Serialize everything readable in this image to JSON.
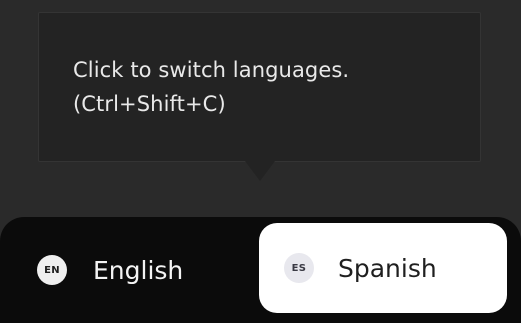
{
  "tooltip": {
    "line1": "Click to switch languages.",
    "line2": "(Ctrl+Shift+C)"
  },
  "language_toggle": {
    "options": [
      {
        "code": "EN",
        "label": "English",
        "selected": false
      },
      {
        "code": "ES",
        "label": "Spanish",
        "selected": true
      }
    ]
  },
  "colors": {
    "background": "#2a2a2a",
    "tooltip_bg": "#232323",
    "toggle_bg": "#0b0b0b",
    "selected_bg": "#ffffff"
  }
}
